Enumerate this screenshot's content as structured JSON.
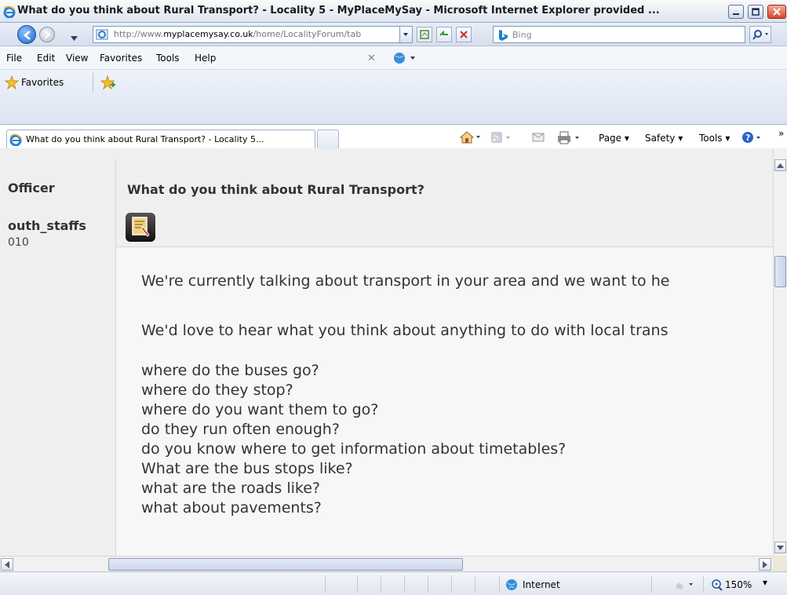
{
  "window": {
    "title": "What do you think about Rural Transport? - Locality 5 - MyPlaceMySay - Microsoft Internet Explorer provided ..."
  },
  "address": {
    "url_prefix": "http://www.",
    "url_domain": "myplacemysay.co.uk",
    "url_path": "/home/LocalityForum/tab"
  },
  "search": {
    "placeholder": "Bing"
  },
  "menu": {
    "items": [
      "File",
      "Edit",
      "View",
      "Favorites",
      "Tools",
      "Help"
    ]
  },
  "favorites": {
    "label": "Favorites"
  },
  "tabs": [
    {
      "label": "What do you think about Rural Transport? - Locality 5..."
    }
  ],
  "commandbar": {
    "page": "Page",
    "safety": "Safety",
    "tools": "Tools"
  },
  "page": {
    "author_role": "Officer",
    "author_name": "outh_staffs",
    "post_date": "010",
    "post_title": "What do you think about Rural Transport?",
    "intro_1": "We're currently talking about transport in your area and we want to he",
    "intro_2": "We'd love to hear what you think about anything to do with local trans",
    "questions": [
      "where do the buses go?",
      "where do they stop?",
      "where do you want them to go?",
      "do they run often enough?",
      "do you know where to get information about timetables?",
      "What are the bus stops like?",
      "what are the roads like?",
      "what about pavements?"
    ]
  },
  "status": {
    "zone": "Internet",
    "zoom": "150%"
  },
  "colors": {
    "title_gradient_top": "#fafafa",
    "close_button": "#d4472a",
    "content_bg": "#efefef",
    "post_bg": "#f7f7f7"
  }
}
